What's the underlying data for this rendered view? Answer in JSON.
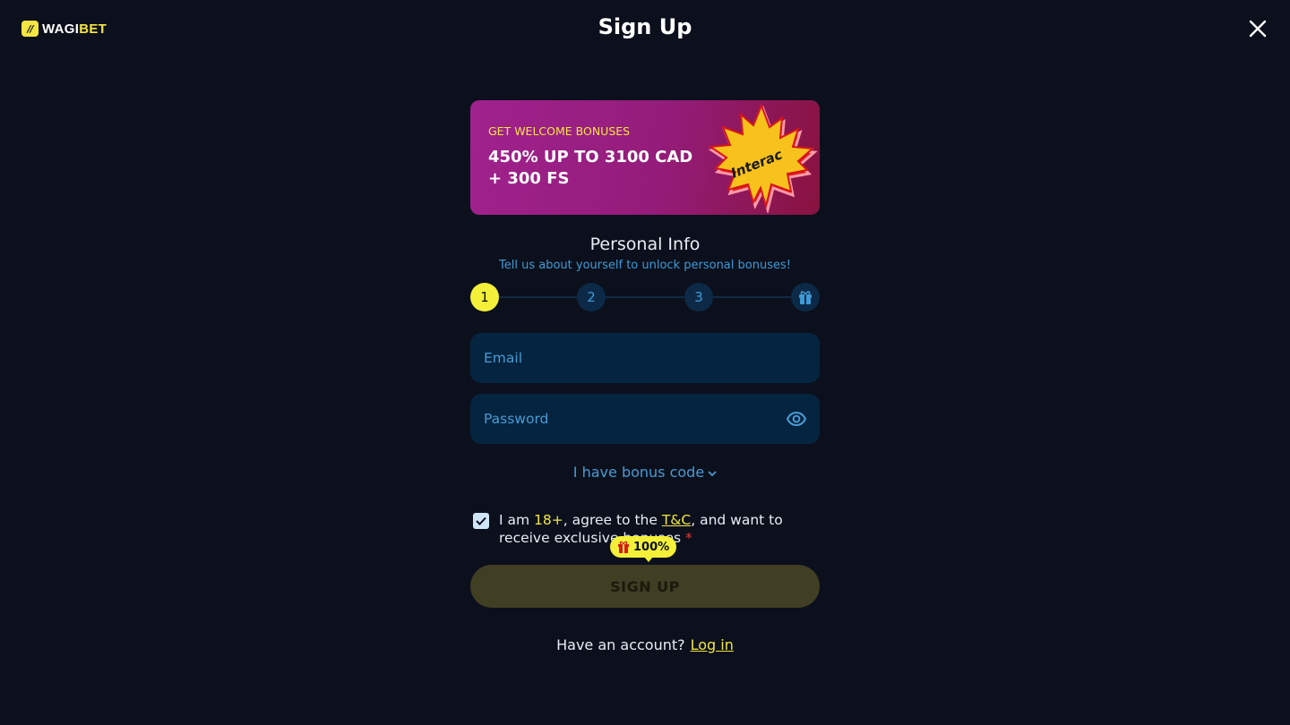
{
  "brand": {
    "wagi": "WAGI",
    "bet": "BET",
    "mark": "//"
  },
  "header": {
    "title": "Sign Up",
    "close_icon": "close-icon"
  },
  "banner": {
    "subtitle": "GET WELCOME BONUSES",
    "headline_line1": "450% UP TO 3100 CAD",
    "headline_line2": "+ 300 FS",
    "art_text": "Interac"
  },
  "section": {
    "title": "Personal Info",
    "subtitle": "Tell us about yourself to unlock personal bonuses!"
  },
  "stepper": {
    "steps": [
      "1",
      "2",
      "3"
    ],
    "active_step": 1,
    "final_icon": "gift-icon"
  },
  "form": {
    "email_placeholder": "Email",
    "email_value": "",
    "password_placeholder": "Password",
    "password_value": "",
    "bonus_code_label": "I have bonus code",
    "agree_checked": true,
    "agree_prefix": "I am ",
    "agree_age": "18+",
    "agree_mid": ", agree to the ",
    "agree_tc": "T&C",
    "agree_suffix": ", and want to receive exclusive bonuses",
    "agree_required": "*",
    "bonus_badge": "100%",
    "submit_label": "SIGN UP"
  },
  "footer": {
    "have_account": "Have an account?",
    "login_label": "Log in"
  },
  "colors": {
    "background": "#0b101c",
    "accent": "#f4e542",
    "field": "#052440",
    "link": "#4a9bd4",
    "banner_start": "#a0228e",
    "banner_end": "#88133f"
  }
}
